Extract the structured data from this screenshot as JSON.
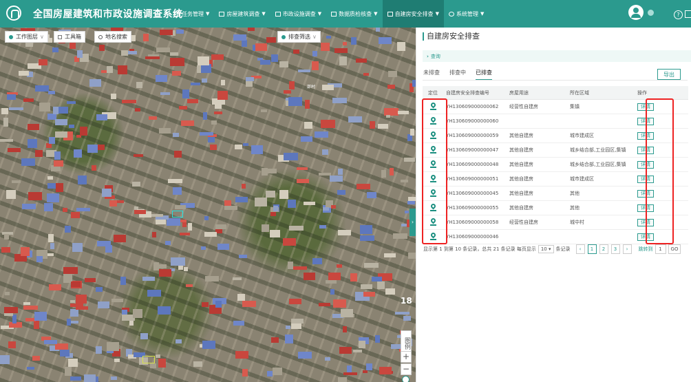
{
  "app": {
    "title": "全国房屋建筑和市政设施调查系统"
  },
  "nav": [
    {
      "label": "任务管理",
      "icon": "task-icon",
      "active": false
    },
    {
      "label": "房屋建筑调查",
      "icon": "house-icon",
      "active": false
    },
    {
      "label": "市政设施调查",
      "icon": "facility-icon",
      "active": false
    },
    {
      "label": "数据质检核查",
      "icon": "table-icon",
      "active": false
    },
    {
      "label": "自建房安全排查",
      "icon": "table-icon",
      "active": true
    },
    {
      "label": "系统管理",
      "icon": "gear-icon",
      "active": false
    }
  ],
  "header_icons": [
    "user-avatar-icon",
    "notification-icon",
    "help-icon",
    "logout-icon"
  ],
  "map": {
    "toolbar": {
      "layers": "工作图层",
      "tools": "工具箱",
      "search": "地名搜索",
      "filter": "排查筛选"
    },
    "zoom_level": "18",
    "legend": "图例",
    "zoom_in": "+",
    "zoom_out": "−",
    "place_label": "邵村"
  },
  "panel": {
    "title": "自建房安全排查",
    "query": "查询",
    "tabs": [
      "未排查",
      "排查中",
      "已排查"
    ],
    "active_tab": "已排查",
    "export": "导出",
    "columns": [
      "定位",
      "自建房安全排查编号",
      "房屋用途",
      "所在区域",
      "操作"
    ],
    "rows": [
      {
        "code": "YH130609000000062",
        "use": "经营性自建房",
        "area": "集镇",
        "action": "详情"
      },
      {
        "code": "YH130609000000060",
        "use": "",
        "area": "",
        "action": "详情"
      },
      {
        "code": "YH130609000000059",
        "use": "其他自建房",
        "area": "城市建成区",
        "action": "详情"
      },
      {
        "code": "YH130609000000047",
        "use": "其他自建房",
        "area": "城乡结合部,工业园区,集镇",
        "action": "详情"
      },
      {
        "code": "YH130609000000048",
        "use": "其他自建房",
        "area": "城乡结合部,工业园区,集镇",
        "action": "详情"
      },
      {
        "code": "YH130609000000051",
        "use": "其他自建房",
        "area": "城市建成区",
        "action": "详情"
      },
      {
        "code": "YH130609000000045",
        "use": "其他自建房",
        "area": "其他",
        "action": "详情"
      },
      {
        "code": "YH130609000000055",
        "use": "其他自建房",
        "area": "其他",
        "action": "详情"
      },
      {
        "code": "YH130609000000058",
        "use": "经营性自建房",
        "area": "城中村",
        "action": "详情"
      },
      {
        "code": "YH130609000000046",
        "use": "",
        "area": "",
        "action": "详情"
      }
    ],
    "pagination": {
      "summary": "显示第 1 到第 10 条记录，总共 21 条记录 每页显示",
      "page_size": "10",
      "per_page_suffix": "条记录",
      "prev": "‹",
      "pages": [
        "1",
        "2",
        "3"
      ],
      "next": "›",
      "jump_label": "跳转到",
      "jump_value": "1",
      "go": "GO"
    }
  },
  "colors": {
    "primary": "#2b9a8e",
    "highlight": "#ee2222"
  }
}
